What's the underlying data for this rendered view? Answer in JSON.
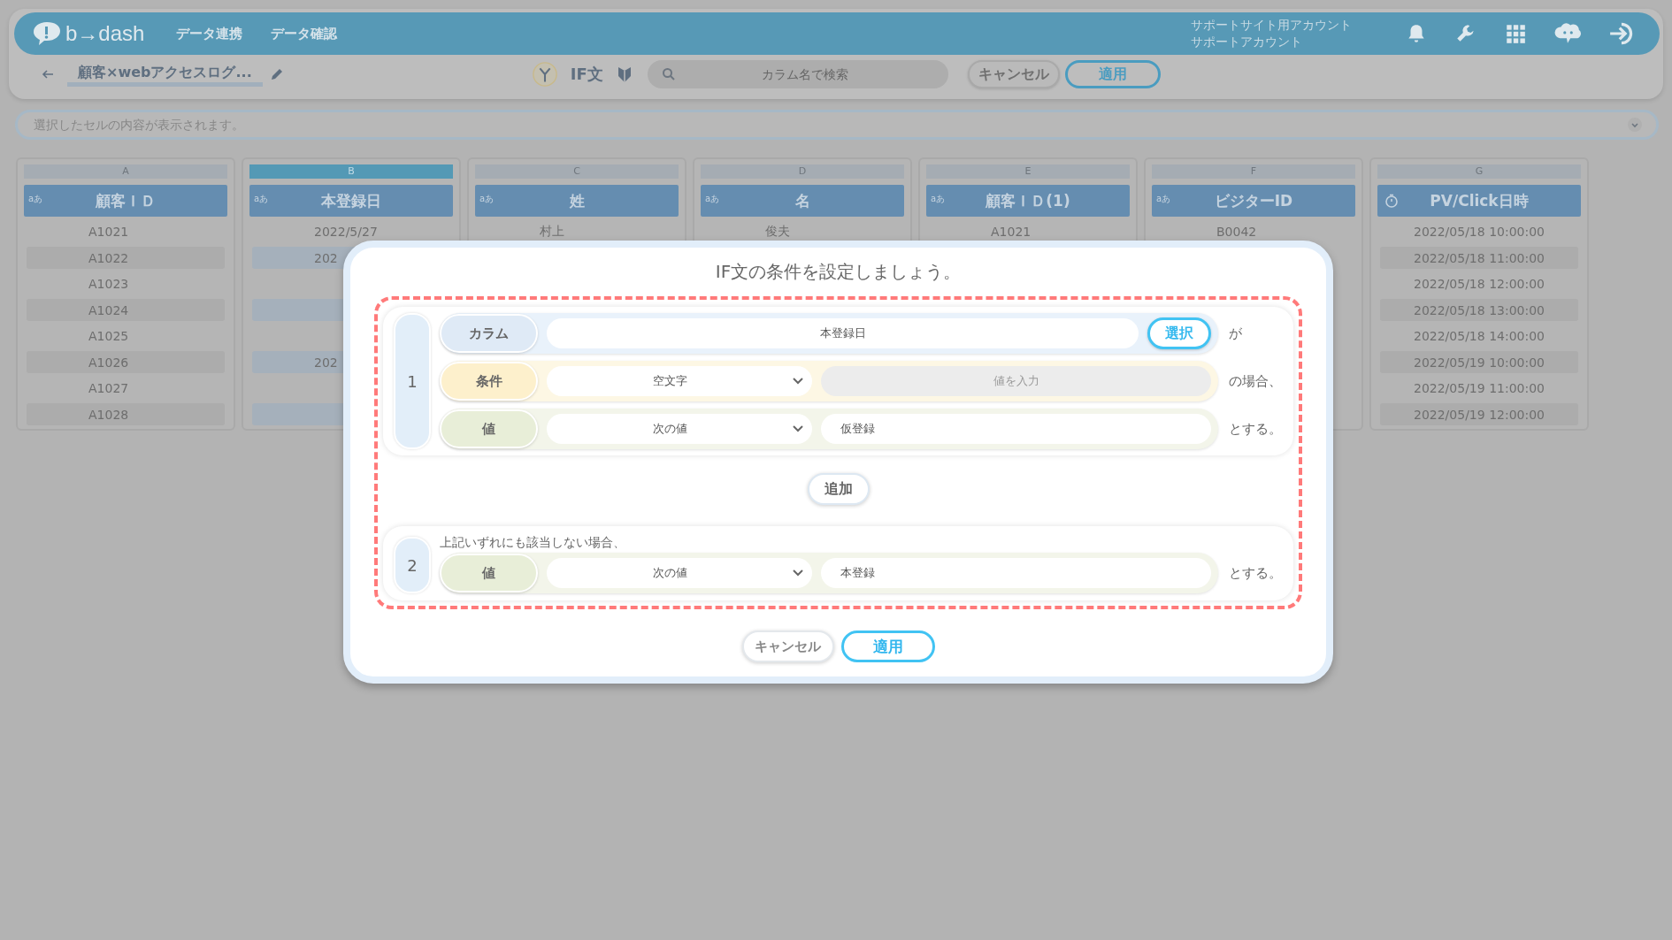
{
  "header": {
    "logo": "b→dash",
    "nav": [
      {
        "label": "データ連携"
      },
      {
        "label": "データ確認"
      }
    ],
    "account": [
      "サポートサイト用アカウント",
      "サポートアカウント"
    ]
  },
  "toolbar": {
    "title": "顧客×webアクセスログ...",
    "function_label": "IF文",
    "search_placeholder": "カラム名で検索",
    "cancel": "キャンセル",
    "apply": "適用"
  },
  "cell_display": {
    "placeholder": "選択したセルの内容が表示されます。"
  },
  "table": {
    "columns": [
      {
        "letter": "A",
        "kind": "text",
        "type_label": "aあ",
        "name": "顧客ＩＤ",
        "selected": false,
        "cells": [
          "A1021",
          "A1022",
          "A1023",
          "A1024",
          "A1025",
          "A1026",
          "A1027",
          "A1028"
        ]
      },
      {
        "letter": "B",
        "kind": "text",
        "type_label": "aあ",
        "name": "本登録日",
        "selected": true,
        "cells": [
          "2022/5/27",
          "202",
          null,
          null,
          null,
          "202",
          null,
          null
        ]
      },
      {
        "letter": "C",
        "kind": "text",
        "type_label": "aあ",
        "name": "姓",
        "selected": false,
        "cells": [
          "村上"
        ]
      },
      {
        "letter": "D",
        "kind": "text",
        "type_label": "aあ",
        "name": "名",
        "selected": false,
        "cells": [
          "俊夫"
        ]
      },
      {
        "letter": "E",
        "kind": "text",
        "type_label": "aあ",
        "name": "顧客ＩＤ(1)",
        "selected": false,
        "cells": [
          "A1021"
        ]
      },
      {
        "letter": "F",
        "kind": "text",
        "type_label": "aあ",
        "name": "ビジターID",
        "selected": false,
        "cells": [
          "B0042"
        ]
      },
      {
        "letter": "G",
        "kind": "datetime",
        "name": "PV/Click日時",
        "selected": false,
        "cells": [
          "2022/05/18 10:00:00",
          "2022/05/18 11:00:00",
          "2022/05/18 12:00:00",
          "2022/05/18 13:00:00",
          "2022/05/18 14:00:00",
          "2022/05/19 10:00:00",
          "2022/05/19 11:00:00",
          "2022/05/19 12:00:00"
        ]
      }
    ]
  },
  "modal": {
    "title": "IF文の条件を設定しましょう。",
    "rules": [
      {
        "number": "1",
        "rows": [
          {
            "kind": "column",
            "label": "カラム",
            "value": "本登録日",
            "button": "選択",
            "suffix": "が"
          },
          {
            "kind": "condition",
            "label": "条件",
            "select": "空文字",
            "placeholder": "値を入力",
            "disabled": true,
            "suffix": "の場合、"
          },
          {
            "kind": "value",
            "label": "値",
            "select": "次の値",
            "value": "仮登録",
            "disabled": false,
            "suffix": "とする。"
          }
        ]
      }
    ],
    "add_button": "追加",
    "default_rule": {
      "number": "2",
      "note": "上記いずれにも該当しない場合、",
      "rows": [
        {
          "kind": "value",
          "label": "値",
          "select": "次の値",
          "value": "本登録",
          "disabled": false,
          "suffix": "とする。"
        }
      ]
    },
    "cancel": "キャンセル",
    "apply": "適用"
  }
}
